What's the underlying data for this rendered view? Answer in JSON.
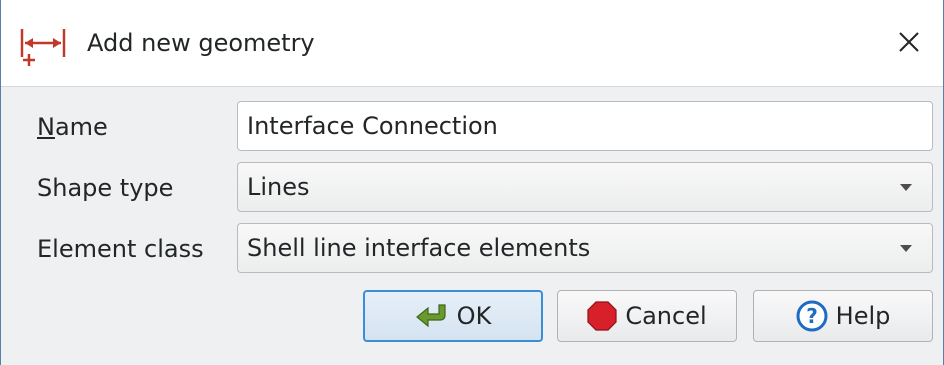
{
  "window": {
    "title": "Add new geometry",
    "icon": "dimension-line-icon",
    "close_icon": "close-icon"
  },
  "form": {
    "name": {
      "label": "Name",
      "mnemonic": "N",
      "label_rest": "ame",
      "value": "Interface Connection"
    },
    "shape_type": {
      "label": "Shape type",
      "value": "Lines"
    },
    "element_class": {
      "label": "Element class",
      "value": "Shell line interface elements"
    }
  },
  "buttons": {
    "ok": {
      "label": "OK",
      "icon": "green-arrow-enter-icon"
    },
    "cancel": {
      "label": "Cancel",
      "icon": "red-stop-icon"
    },
    "help": {
      "label": "Help",
      "icon": "help-circle-icon"
    }
  },
  "colors": {
    "accent": "#3b8ed6",
    "window_border": "#5a7fa8",
    "ok_icon": "#6a9a2e",
    "cancel_icon": "#d8202a",
    "help_icon": "#1f6bc4"
  }
}
